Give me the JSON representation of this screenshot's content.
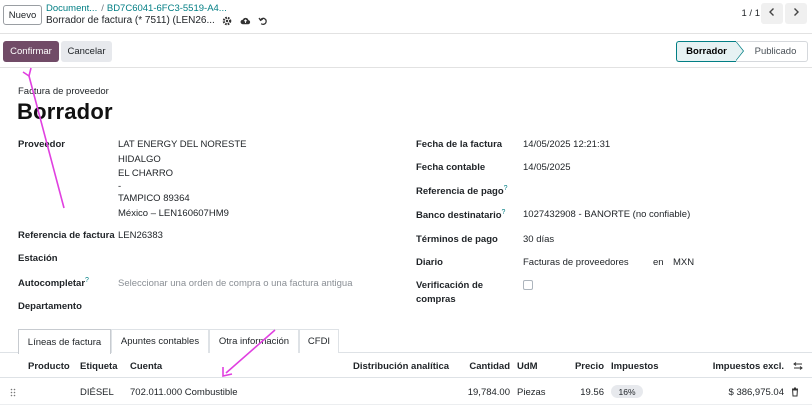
{
  "header": {
    "new_button": "Nuevo",
    "breadcrumb_parent": "Document...",
    "breadcrumb_separator": "/",
    "breadcrumb_record": "BD7C6041-6FC3-5519-A4...",
    "record_title": "Borrador de factura (* 7511) (LEN26...",
    "icons": [
      "gear-icon",
      "cloud-upload-icon",
      "undo-icon"
    ],
    "pager": "1 / 1",
    "pager_prev_icon": "chevron-left-icon",
    "pager_next_icon": "chevron-right-icon"
  },
  "statusbar": {
    "confirm_label": "Confirmar",
    "cancel_label": "Cancelar",
    "stages": [
      "Borrador",
      "Publicado"
    ],
    "active_stage": "Borrador",
    "accent_color": "#714b67",
    "stage_color": "#017e84"
  },
  "form": {
    "type_label": "Factura de proveedor",
    "state_title": "Borrador",
    "left": {
      "vendor_label": "Proveedor",
      "vendor_lines": [
        "LAT ENERGY DEL NORESTE",
        "HIDALGO",
        "EL CHARRO",
        "-",
        "TAMPICO 89364",
        "México – LEN160607HM9"
      ],
      "ref_label": "Referencia de factura",
      "ref_value": "LEN26383",
      "station_label": "Estación",
      "autocomplete_label": "Autocompletar",
      "autocomplete_help": "?",
      "autocomplete_placeholder": "Seleccionar una orden de compra o una factura antigua",
      "department_label": "Departamento"
    },
    "right": {
      "invoice_date_label": "Fecha de la factura",
      "invoice_date_value": "14/05/2025 12:21:31",
      "accounting_date_label": "Fecha contable",
      "accounting_date_value": "14/05/2025",
      "payment_ref_label": "Referencia de pago",
      "payment_ref_help": "?",
      "bank_label": "Banco destinatario",
      "bank_help": "?",
      "bank_value": "1027432908 - BANORTE (no confiable)",
      "terms_label": "Términos de pago",
      "terms_value": "30 días",
      "journal_label": "Diario",
      "journal_value": "Facturas de proveedores",
      "journal_in": "en",
      "journal_currency": "MXN",
      "verification_label_1": "Verificación de",
      "verification_label_2": "compras",
      "verification_checked": false
    }
  },
  "tabs": [
    "Líneas de factura",
    "Apuntes contables",
    "Otra información",
    "CFDI"
  ],
  "active_tab": "Líneas de factura",
  "table": {
    "columns": [
      "Producto",
      "Etiqueta",
      "Cuenta",
      "Distribución analítica",
      "Cantidad",
      "UdM",
      "Precio",
      "Impuestos",
      "Impuestos excl."
    ],
    "settings_icon": "sliders-icon",
    "rows": [
      {
        "handle_icon": "drag-handle-icon",
        "producto": "",
        "etiqueta": "DIÉSEL",
        "cuenta": "702.011.000 Combustible",
        "distribucion": "",
        "cantidad": "19,784.00",
        "udm": "Piezas",
        "precio": "19.56",
        "impuestos": "16%",
        "subtotal": "$ 386,975.04",
        "delete_icon": "trash-icon"
      }
    ]
  },
  "annotation_color": "#e040e0"
}
